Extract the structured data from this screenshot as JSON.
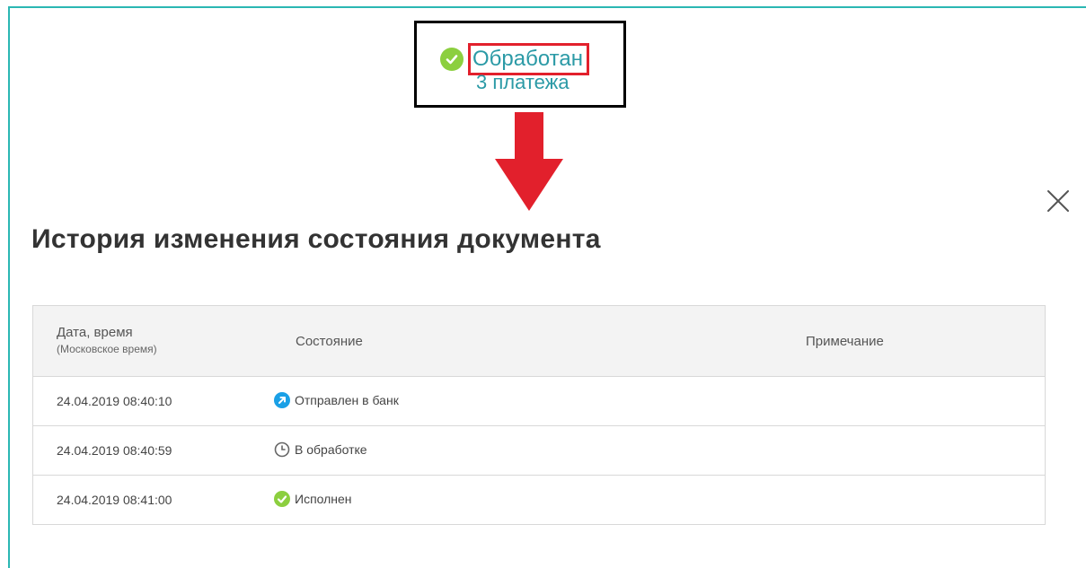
{
  "callout": {
    "status_label": "Обработан",
    "payments_label": "3 платежа"
  },
  "dialog": {
    "title": "История изменения состояния документа",
    "close_icon": "close-icon"
  },
  "table": {
    "headers": {
      "date": "Дата, время",
      "date_sub": "(Московское время)",
      "state": "Состояние",
      "note": "Примечание"
    },
    "rows": [
      {
        "datetime": "24.04.2019 08:40:10",
        "state": "Отправлен в банк",
        "icon": "sent-arrow-icon"
      },
      {
        "datetime": "24.04.2019 08:40:59",
        "state": "В обработке",
        "icon": "clock-icon"
      },
      {
        "datetime": "24.04.2019 08:41:00",
        "state": "Исполнен",
        "icon": "check-icon"
      }
    ]
  },
  "colors": {
    "accent_teal": "#2b9aa6",
    "success_green": "#8ccf3f",
    "sent_blue": "#1aa0e6",
    "annotation_red": "#e2202c"
  }
}
